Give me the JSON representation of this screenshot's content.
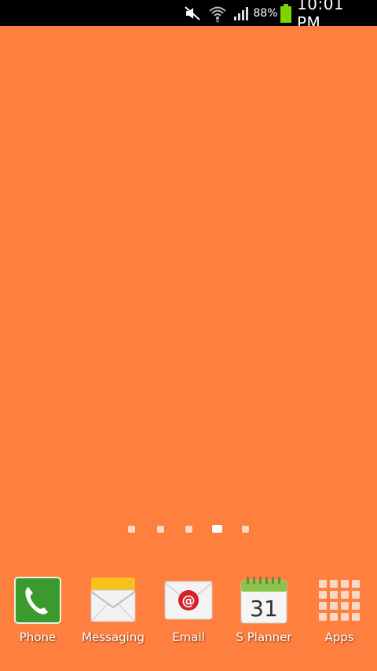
{
  "status_bar": {
    "battery_percent": "88%",
    "time": "10:01 PM",
    "icons": [
      "mute-icon",
      "wifi-icon",
      "signal-icon",
      "battery-icon"
    ],
    "battery_level": 0.88
  },
  "home": {
    "wallpaper_color": "#FF7F3F",
    "page_indicator": {
      "page_count": 5,
      "active_page": 4
    }
  },
  "dock": {
    "apps": [
      {
        "label": "Phone",
        "icon": "phone-icon"
      },
      {
        "label": "Messaging",
        "icon": "messaging-icon"
      },
      {
        "label": "Email",
        "icon": "email-icon"
      },
      {
        "label": "S Planner",
        "icon": "calendar-icon",
        "calendar_day": "31"
      },
      {
        "label": "Apps",
        "icon": "apps-grid-icon"
      }
    ]
  },
  "colors": {
    "status_bar_bg": "#000000",
    "battery_fill": "#7FD400",
    "phone_green": "#3A9A2E",
    "email_red": "#D0242C",
    "planner_green": "#8BC34A"
  }
}
